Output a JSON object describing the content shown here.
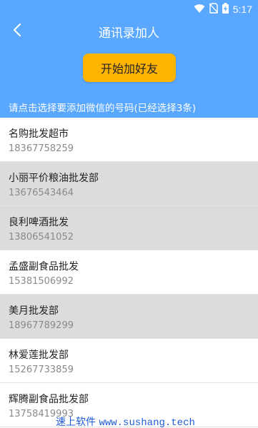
{
  "status_bar": {
    "time": "5:17",
    "icons": [
      "wifi-icon",
      "no-sim-icon",
      "battery-charging-icon"
    ]
  },
  "header": {
    "title": "通讯录加人",
    "back_icon": "chevron-left-icon",
    "start_button_label": "开始加好友",
    "instruction": "请点击选择要添加微信的号码(已经选择3条)"
  },
  "colors": {
    "header_bg": "#59a7ff",
    "button_bg": "#ffb400",
    "selected_row_bg": "#dcdcdc",
    "watermark": "#1e5bd6"
  },
  "contacts": [
    {
      "name": "名购批发超市",
      "phone": "18367758259",
      "selected": false
    },
    {
      "name": "小丽平价粮油批发部",
      "phone": "13676543464",
      "selected": true
    },
    {
      "name": "良利啤酒批发",
      "phone": "13806541052",
      "selected": true
    },
    {
      "name": "孟盛副食品批发",
      "phone": "15381506992",
      "selected": false
    },
    {
      "name": "美月批发部",
      "phone": "18967789299",
      "selected": true
    },
    {
      "name": "林爱莲批发部",
      "phone": "15267733859",
      "selected": false
    },
    {
      "name": "辉腾副食品批发部",
      "phone": "13758419993",
      "selected": false
    }
  ],
  "watermark": {
    "brand": "速上软件",
    "url": "www.sushang.tech"
  }
}
